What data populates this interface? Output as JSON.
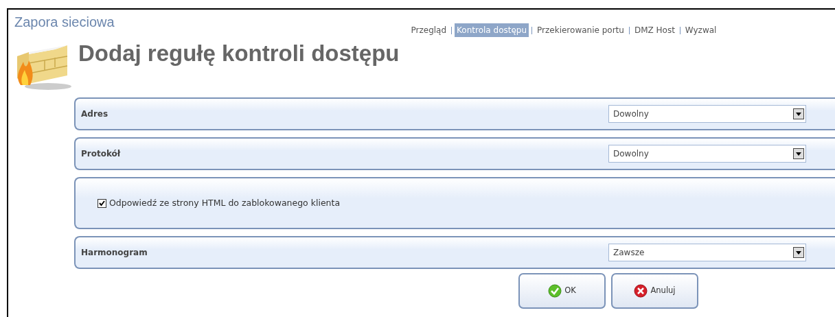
{
  "section_title": "Zapora sieciowa",
  "heading": "Dodaj regułę kontroli dostępu",
  "nav": [
    {
      "label": "Przegląd",
      "selected": false
    },
    {
      "label": "Kontrola dostępu",
      "selected": true
    },
    {
      "label": "Przekierowanie portu",
      "selected": false
    },
    {
      "label": "DMZ Host",
      "selected": false
    },
    {
      "label": "Wyzwal",
      "selected": false
    }
  ],
  "rows": [
    {
      "kind": "select",
      "label": "Adres",
      "value": "Dowolny"
    },
    {
      "kind": "select",
      "label": "Protokół",
      "value": "Dowolny"
    },
    {
      "kind": "checkbox",
      "label": "Odpowiedź ze strony HTML do zablokowanego klienta",
      "checked": true
    },
    {
      "kind": "select",
      "label": "Harmonogram",
      "value": "Zawsze"
    }
  ],
  "buttons": [
    {
      "kind": "ok",
      "label": "OK"
    },
    {
      "kind": "cancel",
      "label": "Anuluj"
    }
  ]
}
